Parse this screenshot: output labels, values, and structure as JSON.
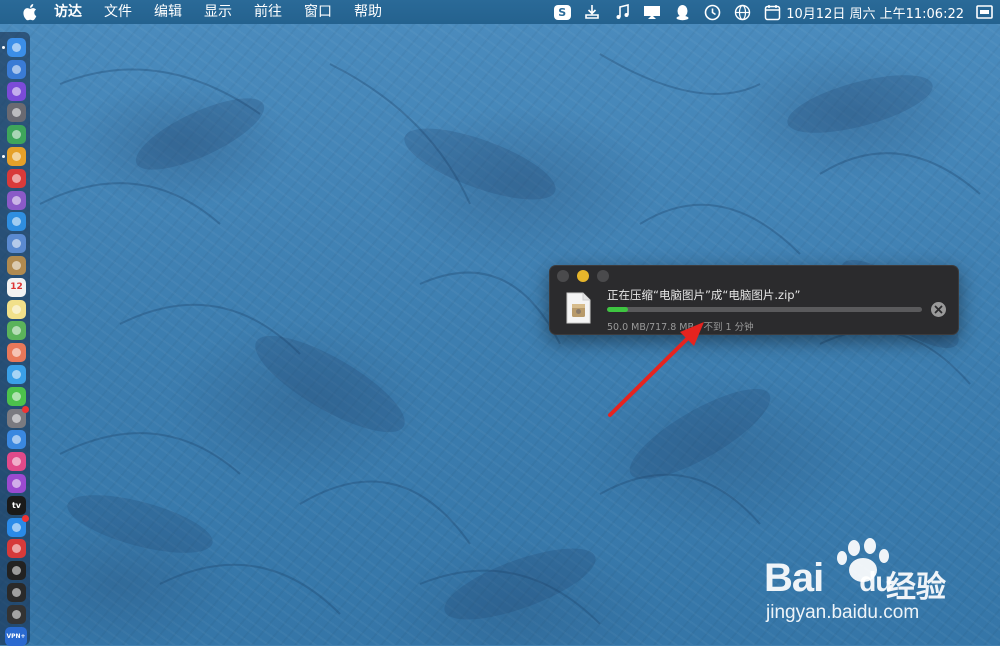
{
  "menubar": {
    "app_name": "访达",
    "menus": [
      "文件",
      "编辑",
      "显示",
      "前往",
      "窗口",
      "帮助"
    ],
    "datetime": "10月12日 周六 上午11:06:22",
    "status_icons": [
      "sogou-input-icon",
      "download-icon",
      "music-icon",
      "screen-mirroring-icon",
      "qq-icon",
      "time-machine-icon",
      "globe-icon",
      "calendar-icon"
    ],
    "input_method": "S"
  },
  "dock": {
    "items": [
      {
        "name": "finder",
        "color": "#3b8ee8"
      },
      {
        "name": "appstore-like",
        "color": "#3a7bd5"
      },
      {
        "name": "siri",
        "color": "#7b4bd8"
      },
      {
        "name": "launchpad",
        "color": "#6a6a72"
      },
      {
        "name": "android-studio",
        "color": "#3ea55b"
      },
      {
        "name": "chrome",
        "color": "#e5a02a"
      },
      {
        "name": "netease-music",
        "color": "#d83a3a"
      },
      {
        "name": "disk-utility",
        "color": "#8a5ac8"
      },
      {
        "name": "safari",
        "color": "#2f8ee0"
      },
      {
        "name": "preview",
        "color": "#5a8ad0"
      },
      {
        "name": "notes-brown",
        "color": "#b08a50"
      },
      {
        "name": "calendar",
        "color": "#f2f2f2"
      },
      {
        "name": "notes",
        "color": "#f1e08a"
      },
      {
        "name": "maps",
        "color": "#5bb35b"
      },
      {
        "name": "photos",
        "color": "#e8785a"
      },
      {
        "name": "messages",
        "color": "#3aa0e8"
      },
      {
        "name": "wechat",
        "color": "#4cc24c"
      },
      {
        "name": "system-preferences",
        "color": "#7a7a80"
      },
      {
        "name": "keynote",
        "color": "#3a88e0"
      },
      {
        "name": "itunes",
        "color": "#e04a8a"
      },
      {
        "name": "podcasts",
        "color": "#9a4ad0"
      },
      {
        "name": "apple-tv",
        "color": "#1a1a1a"
      },
      {
        "name": "app-store",
        "color": "#2a8ae8"
      },
      {
        "name": "vivaldi",
        "color": "#d63a3a"
      },
      {
        "name": "terminal",
        "color": "#222"
      },
      {
        "name": "activity-monitor",
        "color": "#2a2a2a"
      },
      {
        "name": "console",
        "color": "#333"
      },
      {
        "name": "vpn",
        "color": "#2a6ad0"
      }
    ],
    "calendar_day": "12",
    "tv_label": "tv",
    "vpn_label": "VPN+"
  },
  "dialog": {
    "title": "正在压缩“电脑图片”成“电脑图片.zip”",
    "progress_fraction": 0.066,
    "progress_text": "50.0 MB/717.8 MB - 不到 1 分钟",
    "cancel_icon": "cancel-icon",
    "accent_color": "#3ec641"
  },
  "watermark": {
    "brand": "Bai",
    "brand_suffix": "du",
    "cn": "经验",
    "url": "jingyan.baidu.com"
  }
}
